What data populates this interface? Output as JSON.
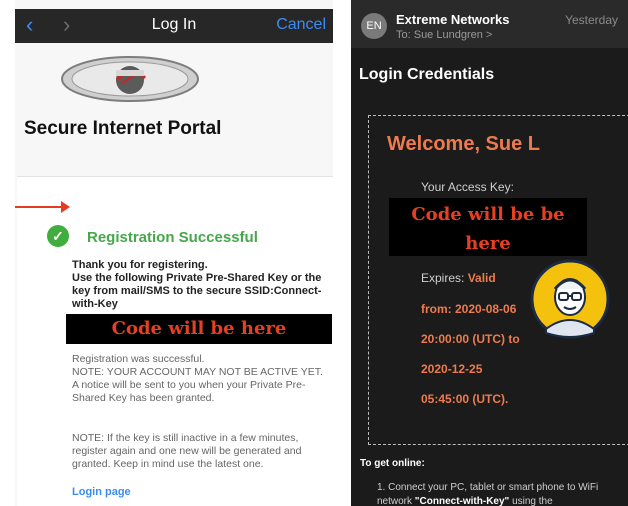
{
  "left": {
    "nav": {
      "back_icon": "chevron-left-icon",
      "forward_icon": "chevron-right-icon",
      "title": "Log In",
      "cancel": "Cancel"
    },
    "portal_title": "Secure Internet Portal",
    "registration": {
      "success_title": "Registration Successful",
      "thanks_line1": "Thank you for registering.",
      "thanks_line2": "Use the following Private Pre-Shared Key or the key from mail/SMS to the secure SSID:Connect-with-Key",
      "code_placeholder": "Code will be here",
      "status_line1": "Registration was successful.",
      "status_line2": "NOTE: YOUR ACCOUNT MAY NOT BE ACTIVE YET.",
      "status_line3": "A notice will be sent to you when your Private Pre-Shared Key has been granted.",
      "note2": "NOTE: If the key is still inactive in a few minutes, register again and one new will be generated and granted. Keep in mind use the latest one.",
      "login_link": "Login page"
    }
  },
  "right": {
    "email": {
      "avatar_initials": "EN",
      "sender": "Extreme Networks",
      "date": "Yesterday",
      "to": "To: Sue Lundgren >",
      "subject": "Login Credentials"
    },
    "ticket": {
      "welcome": "Welcome, Sue L",
      "access_label": "Your Access Key:",
      "code_line1": "Code will be be",
      "code_line2": "here",
      "expires_label": "Expires:",
      "expires_valid": "Valid",
      "exp_line1": "from: 2020-08-06",
      "exp_line2": "20:00:00 (UTC) to",
      "exp_line3": "2020-12-25",
      "exp_line4": "05:45:00 (UTC)."
    },
    "instructions": {
      "heading": "To get online:",
      "step1_prefix": "1. Connect your PC, tablet or smart phone to WiFi network",
      "step1_ssid": "\"Connect-with-Key\"",
      "step1_suffix": "using the"
    }
  },
  "colors": {
    "ios_blue": "#3b8cf5",
    "success_green": "#46a84a",
    "code_red": "#e64022",
    "accent_orange": "#ee7b4f"
  }
}
